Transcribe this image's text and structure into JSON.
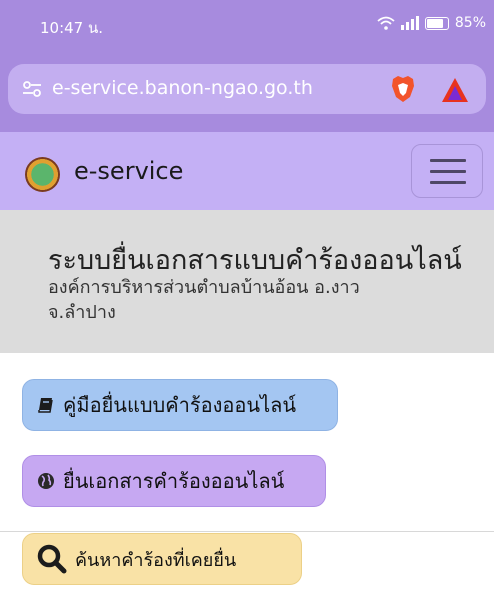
{
  "status_bar": {
    "time": "10:47 น.",
    "battery": "85%",
    "icons": [
      "wifi-icon",
      "signal-icon",
      "battery-icon"
    ]
  },
  "browser": {
    "url": "e-service.banon-ngao.go.th",
    "icons": [
      "site-settings-icon",
      "brave-shields-icon",
      "brave-rewards-icon"
    ]
  },
  "navbar": {
    "brand": "e-service",
    "icons": [
      "logo-icon",
      "hamburger-menu-icon"
    ]
  },
  "header": {
    "title": "ระบบยื่นเอกสารแบบคำร้องออนไลน์",
    "subtitle": "องค์การบริหารส่วนตำบลบ้านอ้อน อ.งาว จ.ลำปาง"
  },
  "actions": {
    "manual_label": "คู่มือยื่นแบบคำร้องออนไลน์",
    "submit_label": "ยื่นเอกสารคำร้องออนไลน์",
    "search_label": "ค้นหาคำร้องที่เคยยื่น"
  },
  "colors": {
    "status_bar": "#a78bde",
    "navbar": "#c4b0f5",
    "header_bg": "#dcdcdc",
    "manual_button": "#a4c6f2",
    "submit_button": "#c6a8f2",
    "search_button": "#f9e2a6"
  }
}
